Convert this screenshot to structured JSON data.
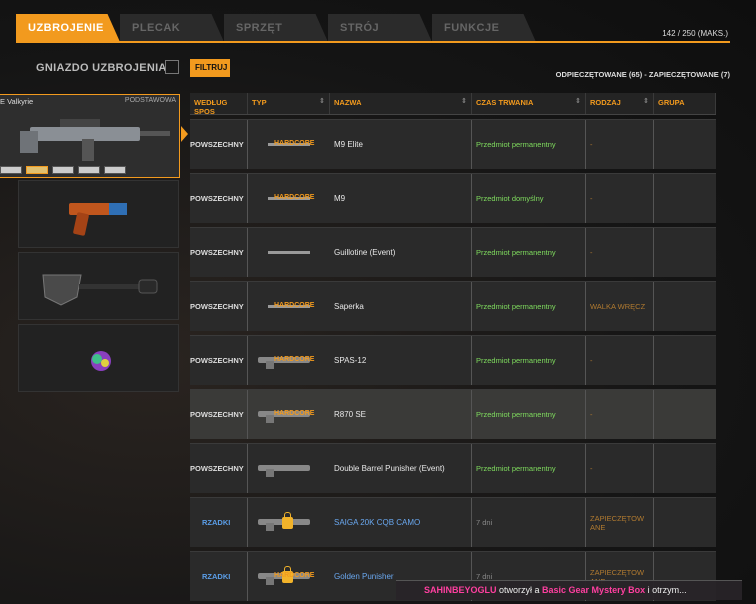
{
  "tabs": [
    {
      "label": "UZBROJENIE",
      "active": true
    },
    {
      "label": "PLECAK",
      "active": false
    },
    {
      "label": "SPRZĘT",
      "active": false
    },
    {
      "label": "STRÓJ",
      "active": false
    },
    {
      "label": "FUNKCJE",
      "active": false
    }
  ],
  "capacity": "142 / 250 (MAKS.)",
  "slot_title": "GNIAZDO UZBROJENIA",
  "filter_label": "FILTRUJ",
  "seal_status": "ODPIECZĘTOWANE (65) - ZAPIECZĘTOWANE (7)",
  "primary_slot": {
    "name": "E Valkyrie",
    "tag": "PODSTAWOWA"
  },
  "columns": [
    "WEDŁUG SPOS",
    "TYP",
    "NAZWA",
    "CZAS TRWANIA",
    "RODZAJ",
    "GRUPA"
  ],
  "rows": [
    {
      "rarity": "POWSZECHNY",
      "type": "HARDCORE",
      "name": "M9 Elite",
      "duration": "Przedmiot permanentny",
      "kind": "-",
      "group": ""
    },
    {
      "rarity": "POWSZECHNY",
      "type": "HARDCORE",
      "name": "M9",
      "duration": "Przedmiot domyślny",
      "kind": "-",
      "group": ""
    },
    {
      "rarity": "POWSZECHNY",
      "type": "",
      "name": "Guillotine (Event)",
      "duration": "Przedmiot permanentny",
      "kind": "-",
      "group": ""
    },
    {
      "rarity": "POWSZECHNY",
      "type": "HARDCORE",
      "name": "Saperka",
      "duration": "Przedmiot permanentny",
      "kind": "WALKA WRĘCZ",
      "group": ""
    },
    {
      "rarity": "POWSZECHNY",
      "type": "HARDCORE",
      "name": "SPAS-12",
      "duration": "Przedmiot permanentny",
      "kind": "-",
      "group": ""
    },
    {
      "rarity": "POWSZECHNY",
      "type": "HARDCORE",
      "name": "R870 SE",
      "duration": "Przedmiot permanentny",
      "kind": "-",
      "group": ""
    },
    {
      "rarity": "POWSZECHNY",
      "type": "",
      "name": "Double Barrel Punisher (Event)",
      "duration": "Przedmiot permanentny",
      "kind": "-",
      "group": ""
    },
    {
      "rarity": "RZADKI",
      "type": "",
      "name": "SAIGA 20K CQB CAMO",
      "duration": "7 dni",
      "kind": "ZAPIECZĘTOW ANE",
      "group": ""
    },
    {
      "rarity": "RZADKI",
      "type": "HARDCORE",
      "name": "Golden Punisher",
      "duration": "7 dni",
      "kind": "ZAPIECZĘTOW ANE",
      "group": ""
    }
  ],
  "notification": {
    "user": "SAHINBEYOGLU",
    "mid": " otworzył a ",
    "item": "Basic Gear Mystery Box",
    "end": "  i otrzym..."
  }
}
